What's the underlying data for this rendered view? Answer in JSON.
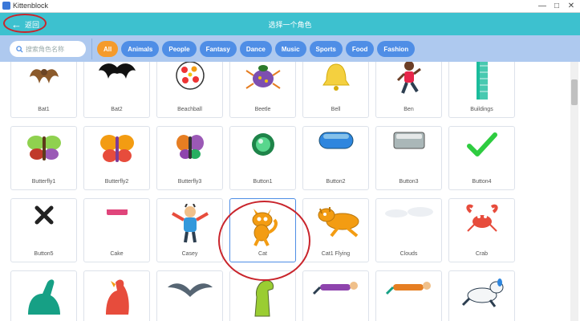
{
  "window": {
    "title": "Kittenblock",
    "min": "—",
    "max": "□",
    "close": "✕"
  },
  "header": {
    "back_label": "返回",
    "title": "选择一个角色"
  },
  "filter": {
    "search_placeholder": "搜索角色名称",
    "chips": [
      {
        "label": "All",
        "active": true
      },
      {
        "label": "Animals",
        "active": false
      },
      {
        "label": "People",
        "active": false
      },
      {
        "label": "Fantasy",
        "active": false
      },
      {
        "label": "Dance",
        "active": false
      },
      {
        "label": "Music",
        "active": false
      },
      {
        "label": "Sports",
        "active": false
      },
      {
        "label": "Food",
        "active": false
      },
      {
        "label": "Fashion",
        "active": false
      }
    ]
  },
  "sprites": [
    {
      "label": "Bat1",
      "icon": "bat-brown-icon"
    },
    {
      "label": "Bat2",
      "icon": "bat-black-icon"
    },
    {
      "label": "Beachball",
      "icon": "beachball-icon"
    },
    {
      "label": "Beetle",
      "icon": "beetle-icon"
    },
    {
      "label": "Bell",
      "icon": "bell-icon"
    },
    {
      "label": "Ben",
      "icon": "ben-person-icon"
    },
    {
      "label": "Buildings",
      "icon": "buildings-icon"
    },
    {
      "label": "Butterfly1",
      "icon": "butterfly-green-icon"
    },
    {
      "label": "Butterfly2",
      "icon": "butterfly-orange-icon"
    },
    {
      "label": "Butterfly3",
      "icon": "butterfly-purple-icon"
    },
    {
      "label": "Button1",
      "icon": "green-orb-button-icon"
    },
    {
      "label": "Button2",
      "icon": "blue-pill-button-icon"
    },
    {
      "label": "Button3",
      "icon": "gray-rect-button-icon"
    },
    {
      "label": "Button4",
      "icon": "green-check-icon"
    },
    {
      "label": "Button5",
      "icon": "black-x-icon"
    },
    {
      "label": "Cake",
      "icon": "cake-icon"
    },
    {
      "label": "Casey",
      "icon": "casey-person-icon"
    },
    {
      "label": "Cat",
      "icon": "cat-icon",
      "selected": true
    },
    {
      "label": "Cat1 Flying",
      "icon": "flying-cat-icon"
    },
    {
      "label": "Clouds",
      "icon": "clouds-icon"
    },
    {
      "label": "Crab",
      "icon": "crab-icon"
    },
    {
      "label": "",
      "icon": "dinosaur-teal-icon"
    },
    {
      "label": "",
      "icon": "dinosaur-red-icon"
    },
    {
      "label": "",
      "icon": "pterodactyl-icon"
    },
    {
      "label": "",
      "icon": "dinosaur-green-icon"
    },
    {
      "label": "",
      "icon": "dancer-lying-icon"
    },
    {
      "label": "",
      "icon": "dancer-orange-icon"
    },
    {
      "label": "",
      "icon": "dog-icon"
    }
  ]
}
